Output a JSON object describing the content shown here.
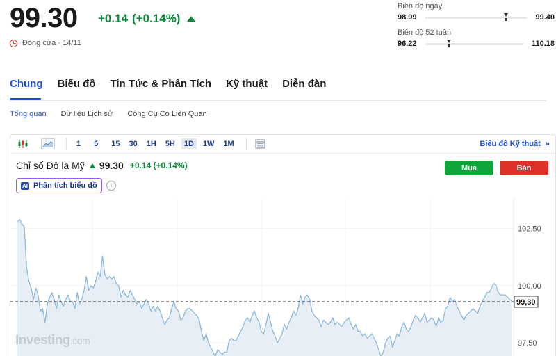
{
  "quote": {
    "price": "99.30",
    "change": "+0.14",
    "change_pct": "(+0.14%)",
    "status": "Đóng cửa · 14/11"
  },
  "day_range": {
    "label": "Biên độ ngày",
    "low": "98.99",
    "high": "99.40",
    "position": 0.77
  },
  "week52_range": {
    "label": "Biên độ 52 tuần",
    "low": "96.22",
    "high": "110.18",
    "position": 0.22
  },
  "tabs": [
    {
      "label": "Chung",
      "active": true
    },
    {
      "label": "Biểu đồ"
    },
    {
      "label": "Tin Tức & Phân Tích"
    },
    {
      "label": "Kỹ thuật"
    },
    {
      "label": "Diễn đàn"
    }
  ],
  "subtabs": [
    {
      "label": "Tổng quan",
      "active": true
    },
    {
      "label": "Dữ liệu Lịch sử"
    },
    {
      "label": "Công Cụ Có Liên Quan"
    }
  ],
  "toolbar": {
    "periods": [
      "1",
      "5",
      "15",
      "30",
      "1H",
      "5H",
      "1D",
      "1W",
      "1M"
    ],
    "active_period": "1D",
    "tech_chart_link": "Biểu đồ Kỹ thuật",
    "icons": [
      "candlestick-icon",
      "area-chart-icon",
      "table-icon",
      "chevron-double-right-icon"
    ]
  },
  "instrument": {
    "name": "Chỉ số Đô la Mỹ",
    "value": "99.30",
    "change": "+0.14 (+0.14%)"
  },
  "buttons": {
    "buy": "Mua",
    "sell": "Bán"
  },
  "ai_button": {
    "badge": "AI",
    "label": "Phân tích biểu đồ"
  },
  "logo": {
    "main": "Investing",
    "suffix": ".com"
  },
  "colors": {
    "accent": "#1d4ed8",
    "up": "#0a8a3a",
    "buy": "#0ea53b",
    "sell": "#e0302a",
    "line": "#8fb8da",
    "area": "#e7eef5"
  },
  "chart_data": {
    "type": "area",
    "y_ticks": [
      "102,50",
      "100,00",
      "97,50"
    ],
    "y_tick_values": [
      102.5,
      100.0,
      97.5
    ],
    "last_value_label": "99,30",
    "last_value": 99.3,
    "grid": true,
    "values": [
      102.8,
      102.9,
      102.7,
      102.6,
      100.8,
      100.2,
      99.9,
      99.4,
      99.9,
      99.6,
      98.9,
      99.0,
      98.4,
      99.2,
      99.5,
      99.7,
      99.4,
      99.0,
      99.6,
      99.3,
      99.1,
      99.4,
      99.6,
      99.3,
      99.3,
      99.0,
      99.7,
      99.2,
      99.4,
      99.8,
      100.4,
      99.8,
      100.0,
      99.9,
      100.2,
      100.6,
      100.4,
      101.3,
      100.5,
      100.3,
      100.4,
      100.3,
      100.4,
      100.1,
      100.0,
      99.5,
      99.8,
      99.6,
      99.5,
      99.8,
      99.6,
      99.4,
      99.2,
      99.3,
      99.0,
      99.2,
      99.4,
      99.2,
      98.9,
      99.1,
      98.9,
      99.1,
      98.9,
      98.6,
      98.3,
      98.5,
      98.6,
      99.0,
      99.3,
      99.0,
      98.9,
      98.5,
      98.6,
      98.9,
      99.0,
      99.0,
      98.9,
      98.8,
      98.7,
      98.5,
      98.0,
      97.6,
      97.9,
      97.5,
      97.3,
      97.1,
      96.9,
      97.2,
      97.1,
      97.0,
      97.1,
      97.1,
      97.6,
      97.7,
      97.6,
      97.6,
      97.8,
      98.0,
      98.2,
      98.5,
      98.6,
      98.4,
      98.7,
      98.9,
      98.6,
      98.4,
      98.0,
      97.9,
      98.3,
      98.8,
      98.4,
      98.0,
      97.8,
      97.5,
      97.7,
      97.9,
      98.3,
      98.1,
      98.4,
      98.6,
      98.9,
      98.7,
      99.0,
      99.6,
      99.2,
      99.5,
      99.6,
      99.4,
      98.9,
      98.7,
      98.6,
      98.5,
      98.2,
      98.5,
      98.4,
      98.3,
      98.4,
      98.6,
      98.3,
      98.4,
      98.3,
      98.2,
      98.4,
      98.5,
      98.6,
      98.3,
      98.1,
      98.3,
      98.0,
      98.0,
      97.8,
      97.9,
      97.7,
      97.8,
      97.9,
      97.7,
      97.5,
      97.2,
      96.9,
      97.1,
      97.5,
      97.7,
      97.8,
      97.3,
      97.6,
      97.9,
      97.8,
      98.2,
      98.4,
      98.1,
      98.0,
      98.2,
      98.5,
      98.7,
      98.6,
      98.4,
      98.6,
      98.8,
      98.4,
      98.5,
      98.6,
      98.5,
      98.2,
      98.6,
      98.4,
      98.5,
      99.0,
      99.1,
      99.5,
      99.3,
      99.4,
      99.1,
      98.9,
      98.7,
      98.5,
      98.7,
      98.8,
      98.9,
      99.0,
      98.9,
      98.8,
      99.1,
      99.3,
      99.5,
      99.7,
      99.7,
      99.9,
      100.1,
      100.0,
      99.7,
      99.6,
      99.6,
      99.6,
      99.5,
      99.4,
      99.3
    ],
    "y_min": 96.5,
    "y_max": 103.8
  }
}
